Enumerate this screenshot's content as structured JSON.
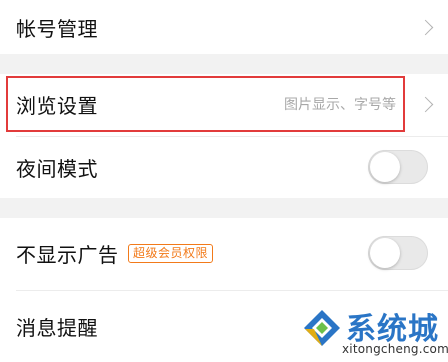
{
  "settings": {
    "account": {
      "label": "帐号管理"
    },
    "browse": {
      "label": "浏览设置",
      "hint": "图片显示、字号等"
    },
    "night_mode": {
      "label": "夜间模式",
      "enabled": false
    },
    "no_ads": {
      "label": "不显示广告",
      "badge": "超级会员权限",
      "enabled": false
    },
    "notifications": {
      "label": "消息提醒"
    }
  },
  "watermark": {
    "name": "系统城",
    "url": "xitongcheng.com"
  },
  "colors": {
    "highlight": "#e23b3b",
    "badge": "#f27a1a",
    "watermark_blue": "#2a75c6",
    "watermark_green": "#6cc04a"
  }
}
